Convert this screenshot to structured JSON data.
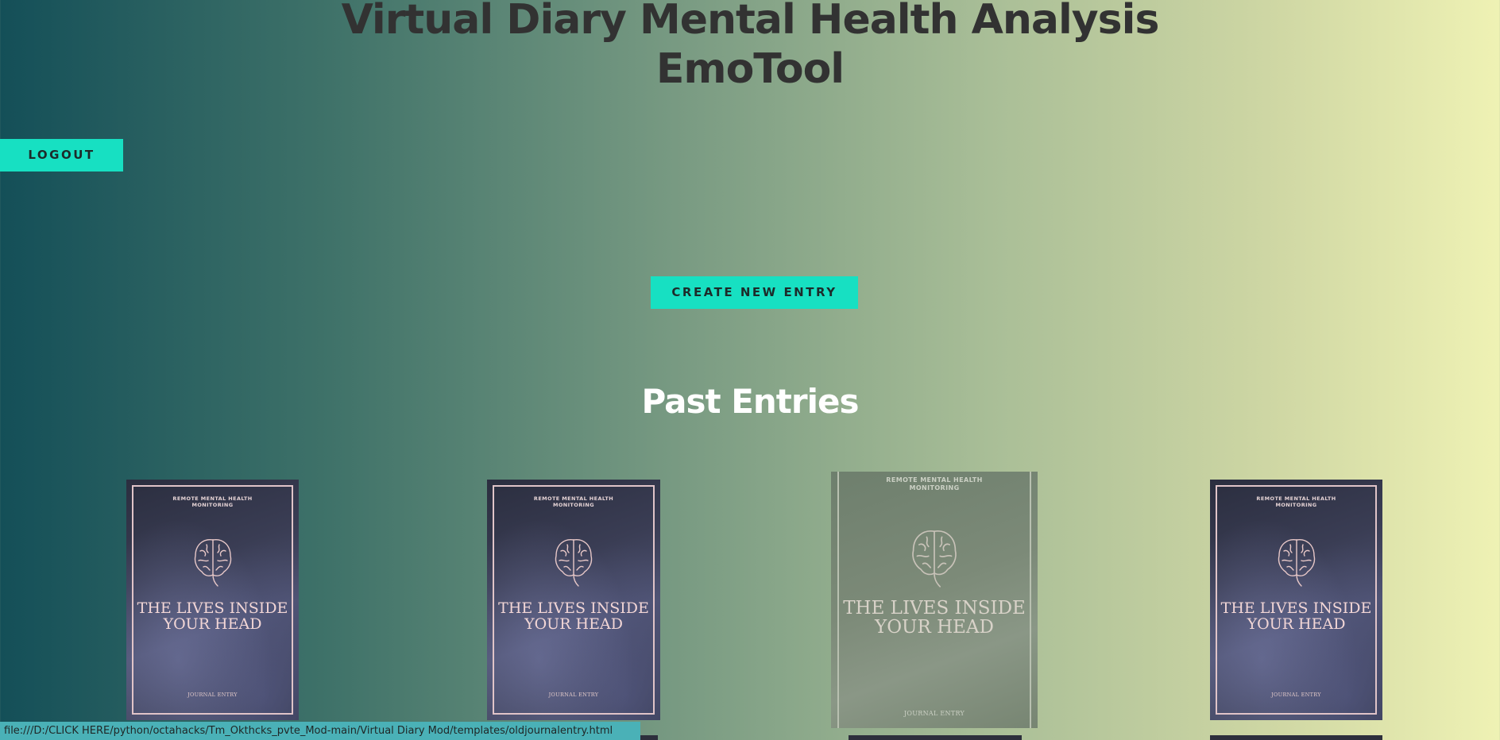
{
  "header": {
    "title_line1": "Virtual Diary Mental Health Analysis",
    "title_line2": "EmoTool"
  },
  "buttons": {
    "logout": "LOGOUT",
    "create_entry": "CREATE NEW ENTRY"
  },
  "past_entries": {
    "heading": "Past Entries",
    "entries": [
      {
        "top_text": "REMOTE MENTAL HEALTH MONITORING",
        "headline": "THE LIVES INSIDE YOUR HEAD",
        "bottom_text": "JOURNAL ENTRY"
      },
      {
        "top_text": "REMOTE MENTAL HEALTH MONITORING",
        "headline": "THE LIVES INSIDE YOUR HEAD",
        "bottom_text": "JOURNAL ENTRY"
      },
      {
        "top_text": "REMOTE MENTAL HEALTH MONITORING",
        "headline": "THE LIVES INSIDE YOUR HEAD",
        "bottom_text": "JOURNAL ENTRY"
      },
      {
        "top_text": "REMOTE MENTAL HEALTH MONITORING",
        "headline": "THE LIVES INSIDE YOUR HEAD",
        "bottom_text": "JOURNAL ENTRY"
      }
    ]
  },
  "status_bar": {
    "url": "file:///D:/CLICK HERE/python/octahacks/Tm_Okthcks_pvte_Mod-main/Virtual Diary Mod/templates/oldjournalentry.html"
  },
  "colors": {
    "accent": "#17e0c2",
    "title_text": "#323232",
    "status_bar": "#4ab1b7"
  }
}
